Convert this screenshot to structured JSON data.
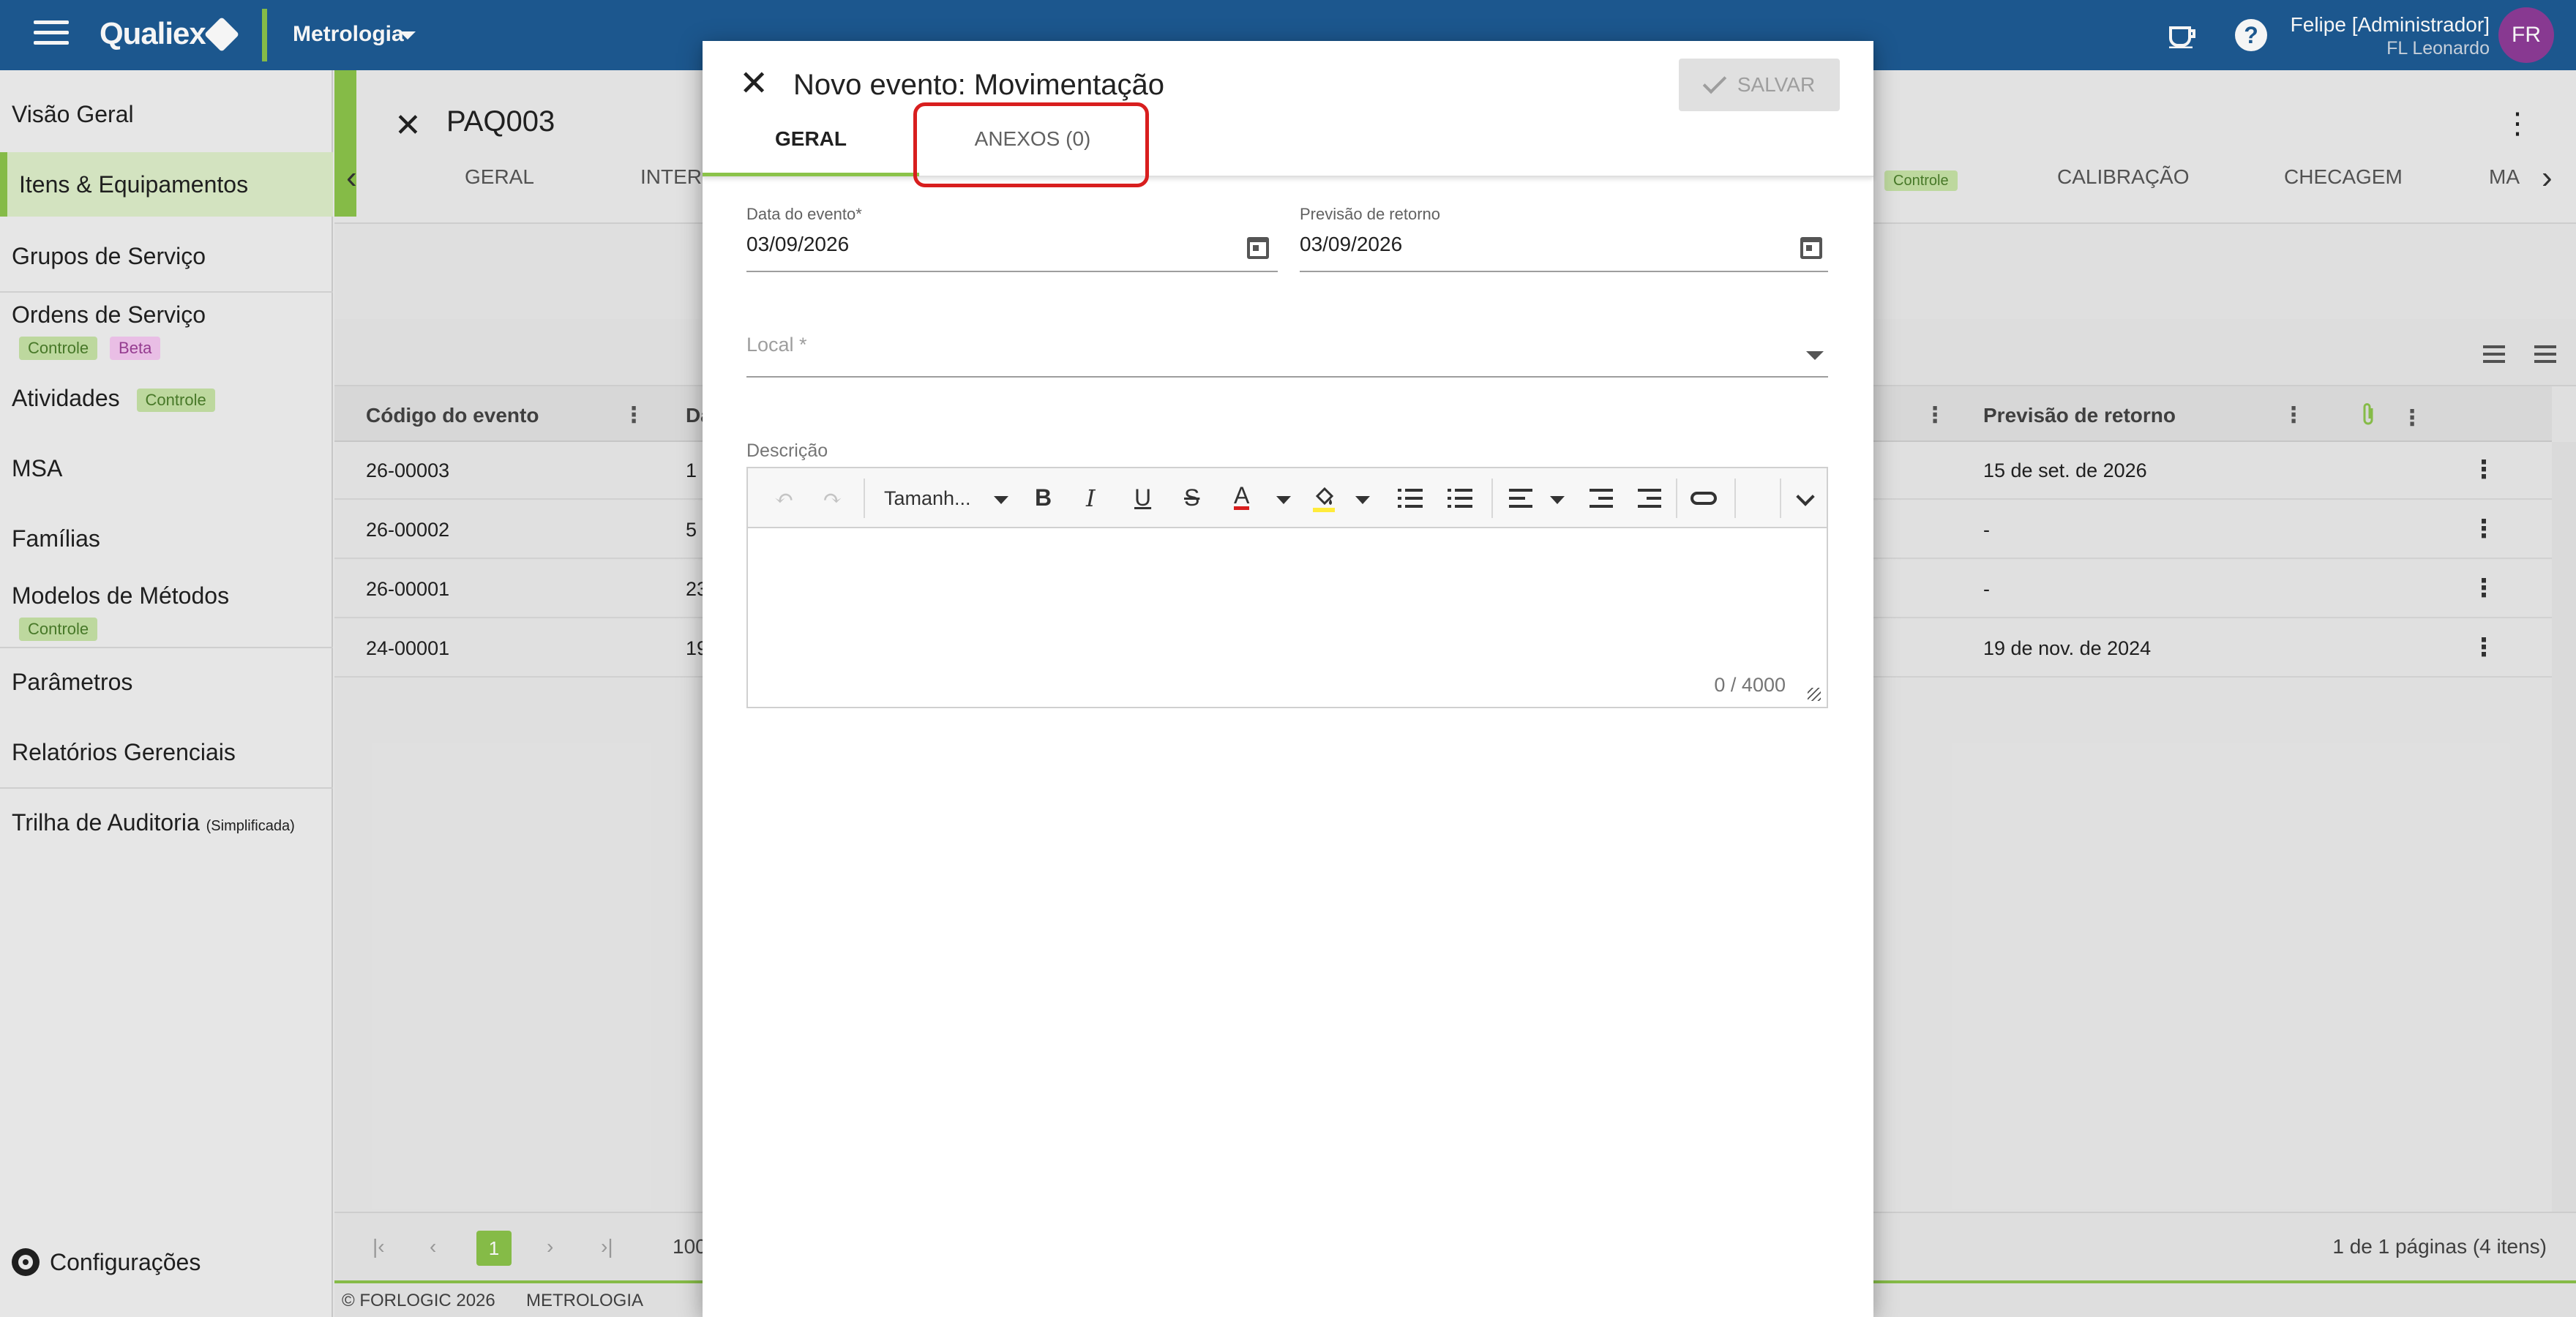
{
  "topbar": {
    "logo": "Qualiex",
    "module": "Metrologia",
    "user_name": "Felipe [Administrador]",
    "user_org": "FL Leonardo",
    "avatar_initials": "FR",
    "help_glyph": "?"
  },
  "sidebar": {
    "items": [
      {
        "label": "Visão Geral"
      },
      {
        "label": "Itens & Equipamentos"
      },
      {
        "label": "Grupos de Serviço"
      },
      {
        "label": "Ordens de Serviço",
        "badges": [
          "Controle",
          "Beta"
        ]
      },
      {
        "label": "Atividades",
        "badges": [
          "Controle"
        ]
      },
      {
        "label": "MSA"
      },
      {
        "label": "Famílias"
      },
      {
        "label": "Modelos de Métodos",
        "badges": [
          "Controle"
        ]
      },
      {
        "label": "Parâmetros"
      },
      {
        "label": "Relatórios Gerenciais"
      },
      {
        "label": "Trilha de Auditoria",
        "small": "(Simplificada)"
      }
    ],
    "config_label": "Configurações"
  },
  "page": {
    "title": "PAQ003",
    "tabs": [
      "GERAL",
      "INTER",
      "Controle",
      "CALIBRAÇÃO",
      "CHECAGEM",
      "MA"
    ],
    "grid": {
      "headers": [
        "Código do evento",
        "Da",
        "Previsão de retorno"
      ],
      "rows": [
        {
          "code": "26-00003",
          "date": "1",
          "return": "15 de set. de 2026"
        },
        {
          "code": "26-00002",
          "date": "5",
          "return": "-"
        },
        {
          "code": "26-00001",
          "date": "23",
          "return": "-"
        },
        {
          "code": "24-00001",
          "date": "19",
          "return": "19 de nov. de 2024"
        }
      ]
    },
    "pager": {
      "page_number": "1",
      "page_size": "100",
      "info": "1 de 1 páginas (4 itens)"
    },
    "footer": {
      "copyright": "© FORLOGIC 2026",
      "module": "METROLOGIA"
    }
  },
  "dialog": {
    "title": "Novo evento: Movimentação",
    "save_label": "SALVAR",
    "tabs": {
      "general": "GERAL",
      "attachments": "ANEXOS (0)"
    },
    "fields": {
      "event_date_label": "Data do evento*",
      "event_date_value": "03/09/2026",
      "return_date_label": "Previsão de retorno",
      "return_date_value": "03/09/2026",
      "location_label": "Local *",
      "description_label": "Descrição"
    },
    "editor": {
      "font_size_label": "Tamanh...",
      "counter": "0 / 4000"
    }
  }
}
